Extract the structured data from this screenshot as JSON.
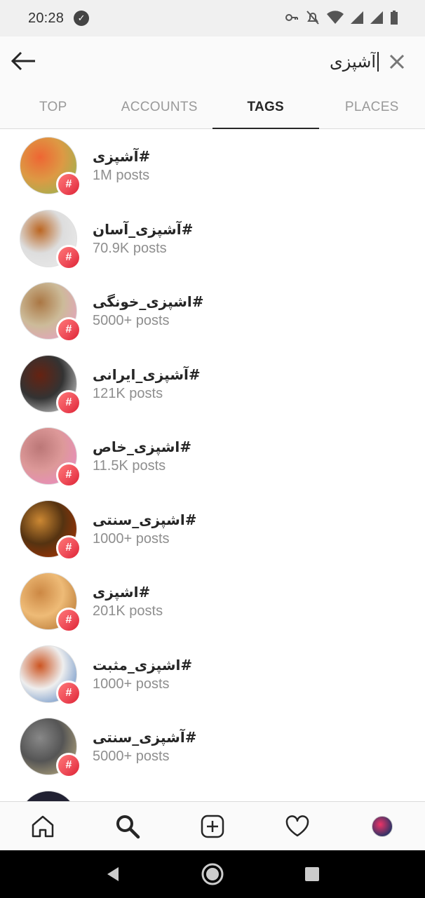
{
  "status_bar": {
    "time": "20:28",
    "vpn_icon": "vpn-key-icon"
  },
  "search": {
    "query": "آشپزی"
  },
  "tabs": [
    {
      "label": "TOP",
      "active": false
    },
    {
      "label": "ACCOUNTS",
      "active": false
    },
    {
      "label": "TAGS",
      "active": true
    },
    {
      "label": "PLACES",
      "active": false
    }
  ],
  "tags": [
    {
      "name": "#آشپزی",
      "count": "1M posts",
      "thumb_colors": [
        "#d94",
        "#e63",
        "#8b5"
      ]
    },
    {
      "name": "#آشپزی_آسان",
      "count": "70.9K posts",
      "thumb_colors": [
        "#ddd",
        "#b62",
        "#eee"
      ]
    },
    {
      "name": "#اشپزی_خونگی",
      "count": "5000+ posts",
      "thumb_colors": [
        "#cb9",
        "#a74",
        "#e9c"
      ]
    },
    {
      "name": "#آشپزی_ایرانی",
      "count": "121K posts",
      "thumb_colors": [
        "#333",
        "#621",
        "#eee"
      ]
    },
    {
      "name": "#اشپزی_خاص",
      "count": "11.5K posts",
      "thumb_colors": [
        "#d99",
        "#b77",
        "#e8c"
      ]
    },
    {
      "name": "#اشپزی_سنتی",
      "count": "1000+ posts",
      "thumb_colors": [
        "#531",
        "#c83",
        "#b30"
      ]
    },
    {
      "name": "#اشپزی",
      "count": "201K posts",
      "thumb_colors": [
        "#eb7",
        "#c84",
        "#a62"
      ]
    },
    {
      "name": "#اشپزی_مثبت",
      "count": "1000+ posts",
      "thumb_colors": [
        "#eee",
        "#c52",
        "#47b"
      ]
    },
    {
      "name": "#آشپزی_سنتی",
      "count": "5000+ posts",
      "thumb_colors": [
        "#555",
        "#888",
        "#cb8"
      ]
    }
  ],
  "badge_color": "#ed4956",
  "nav_icons": [
    "home-icon",
    "search-icon",
    "new-post-icon",
    "activity-heart-icon",
    "profile-avatar"
  ]
}
